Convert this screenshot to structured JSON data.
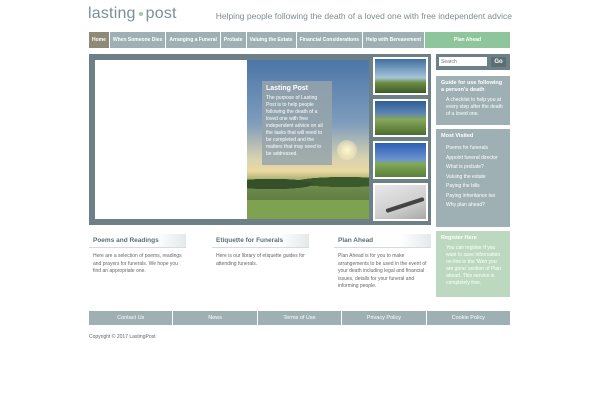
{
  "header": {
    "logo_left": "lasting",
    "logo_right": "post",
    "tagline": "Helping people following the death of a loved one with free independent advice"
  },
  "nav": {
    "items": [
      {
        "label": "Home"
      },
      {
        "label": "When Someone Dies"
      },
      {
        "label": "Arranging a Funeral"
      },
      {
        "label": "Probate"
      },
      {
        "label": "Valuing the Estate"
      },
      {
        "label": "Financial Considerations"
      },
      {
        "label": "Help with Bereavement"
      },
      {
        "label": "Plan Ahead"
      }
    ]
  },
  "hero": {
    "title": "Lasting Post",
    "text": "The purpose of Lasting Post is to help people following the death of a loved one with free independent advice on all the tasks that will need to be completed and the matters that may need to be addressed."
  },
  "search": {
    "placeholder": "Search",
    "button_label": "Go"
  },
  "sidebar": {
    "guide": {
      "title": "Guide for use following a person's death",
      "text": "A checklist to help you at every step after the death of a loved one."
    },
    "most_visited": {
      "title": "Most Visited",
      "items": [
        "Poems for funerals",
        "Appoint funeral director",
        "What is probate?",
        "Valuing the estate",
        "Paying the bills",
        "Paying inheritance tax",
        "Why plan ahead?"
      ]
    },
    "register": {
      "title": "Register Here",
      "text": "You can register if you want to save information on-line in the 'Wen you are gone' section of Plan ahead. This service is completely free."
    }
  },
  "columns": [
    {
      "title": "Poems and Readings",
      "text": "Here are a selection of poems, readings and prayers for funerals. We hope you find an appropriate one."
    },
    {
      "title": "Etiquette for Funerals",
      "text": "Here is our library of etiquette guides for attending funerals."
    },
    {
      "title": "Plan Ahead",
      "text": "Plan Ahead is for you to make arrangements to be used in the event of your death including legal and financial issues, details for your funeral and informing people."
    }
  ],
  "footer": {
    "items": [
      "Contact Us",
      "News",
      "Terms of Use",
      "Privacy Policy",
      "Cookie Policy"
    ],
    "copyright": "Copyright © 2017 LastingPost"
  },
  "colors": {
    "nav_bg": "#9fb0b5",
    "nav_active": "#8e8a77",
    "accent_green": "#8fc59a",
    "dark_slate": "#6e8087"
  }
}
